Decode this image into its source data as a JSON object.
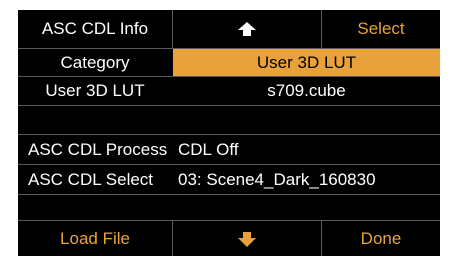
{
  "header": {
    "title": "ASC CDL Info",
    "up_icon": "up-arrow-icon",
    "select_label": "Select"
  },
  "category": {
    "label": "Category",
    "value": "User 3D LUT"
  },
  "user_3d_lut": {
    "label": "User 3D LUT",
    "value": "s709.cube"
  },
  "asc_cdl_process": {
    "label": "ASC CDL Process",
    "value": "CDL Off"
  },
  "asc_cdl_select": {
    "label": "ASC CDL Select",
    "value": "03: Scene4_Dark_160830"
  },
  "footer": {
    "load_file_label": "Load File",
    "down_icon": "down-arrow-icon",
    "done_label": "Done"
  },
  "colors": {
    "background": "#000000",
    "accent": "#e9a23b",
    "text": "#ffffff"
  }
}
